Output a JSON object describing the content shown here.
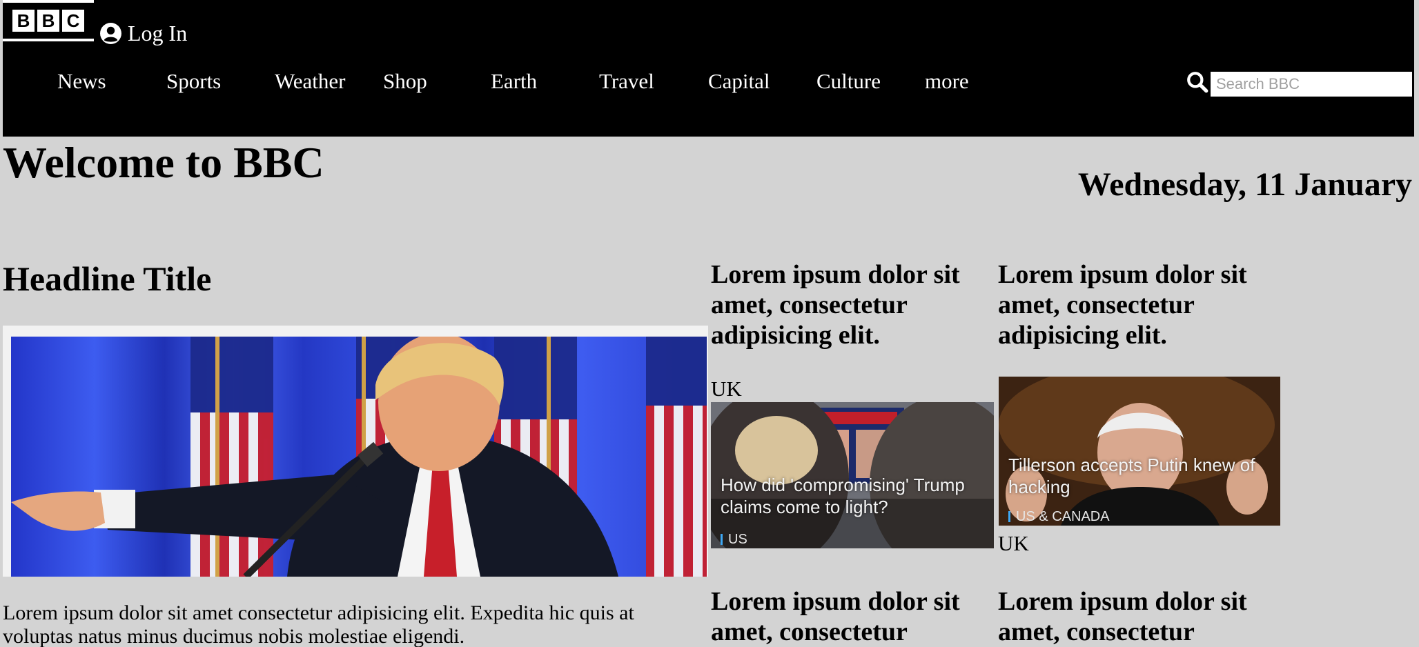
{
  "brand": {
    "logo_letters": [
      "B",
      "B",
      "C"
    ]
  },
  "header": {
    "login_label": "Log In",
    "nav": [
      "News",
      "Sports",
      "Weather",
      "Shop",
      "Earth",
      "Travel",
      "Capital",
      "Culture",
      "more"
    ],
    "search_placeholder": "Search BBC"
  },
  "page": {
    "welcome": "Welcome to BBC",
    "date": "Wednesday, 11 January"
  },
  "main": {
    "headline": "Headline Title",
    "body": "Lorem ipsum dolor sit amet consectetur adipisicing elit. Expedita hic quis at voluptas natus minus ducimus nobis molestiae eligendi."
  },
  "cards": [
    {
      "title": "Lorem ipsum dolor sit amet, consectetur adipisicing elit.",
      "region": "UK",
      "thumb_caption": "How did 'compromising' Trump claims come to light?",
      "thumb_tag": "US"
    },
    {
      "title": "Lorem ipsum dolor sit amet, consectetur adipisicing elit.",
      "region": "UK",
      "thumb_caption": "Tillerson accepts Putin knew of hacking",
      "thumb_tag": "US & CANADA"
    },
    {
      "title": "Lorem ipsum dolor sit amet, consectetur"
    },
    {
      "title": "Lorem ipsum dolor sit amet, consectetur"
    }
  ],
  "colors": {
    "header_bg": "#000000",
    "page_bg": "#d3d3d3",
    "tag_accent": "#3fa9f5"
  }
}
